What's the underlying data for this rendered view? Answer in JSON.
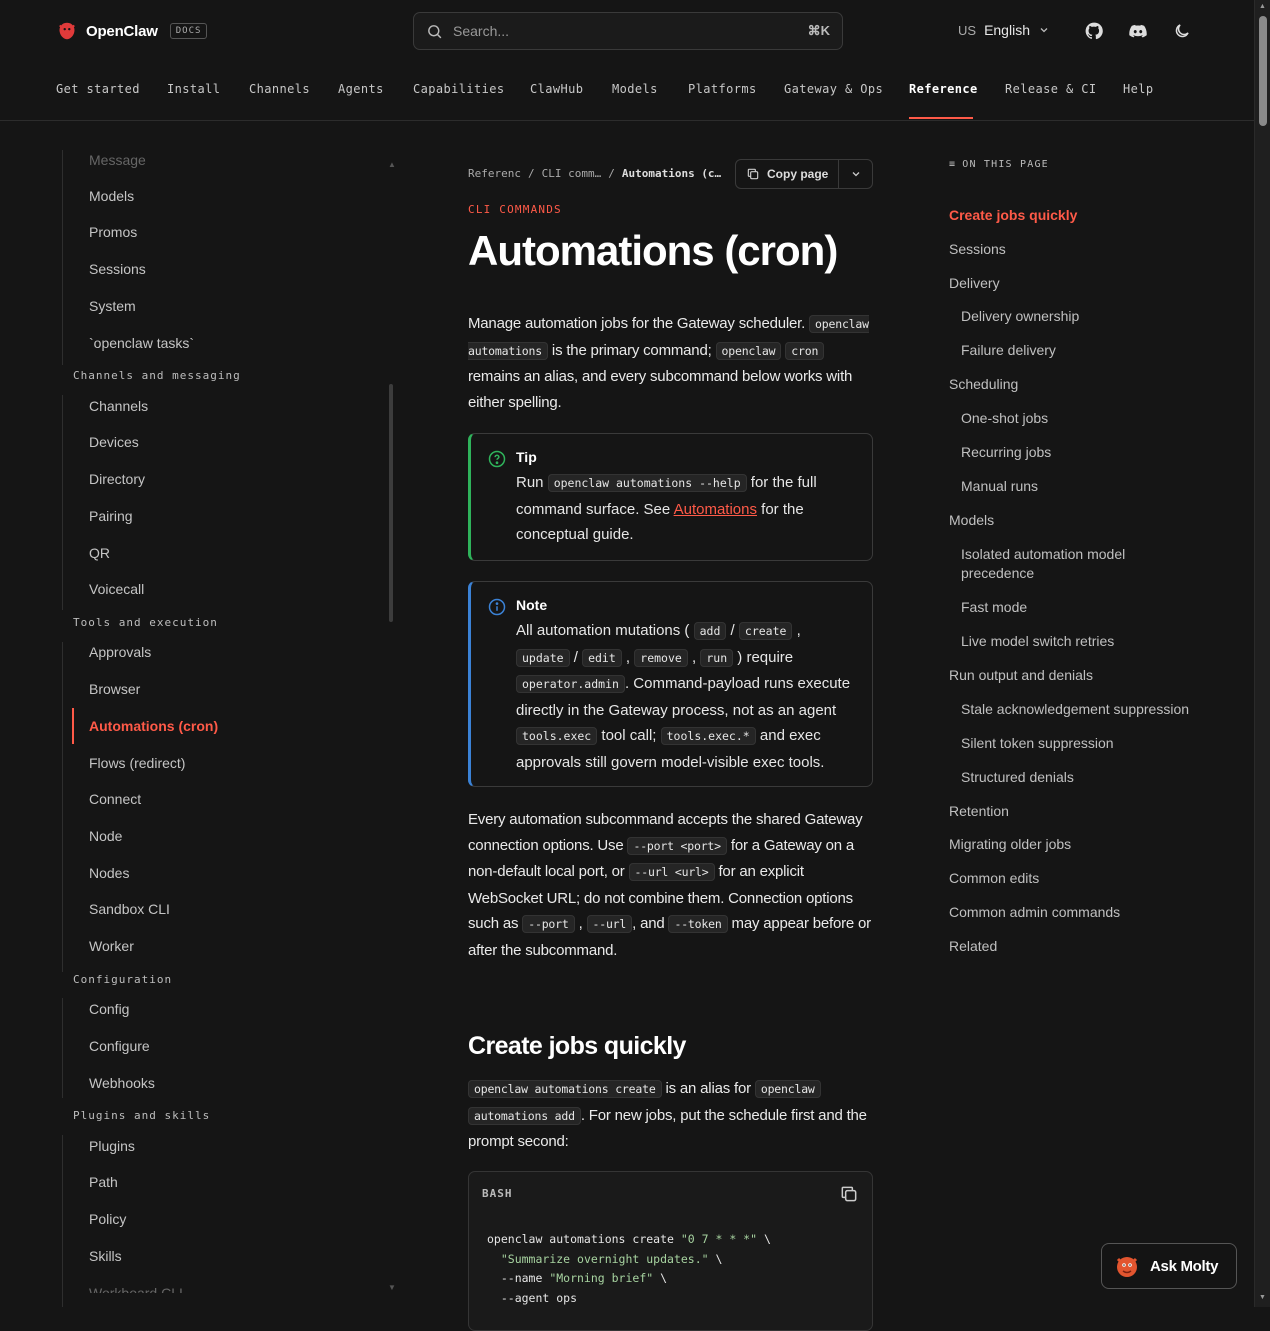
{
  "header": {
    "brand": "OpenClaw",
    "docs_badge": "DOCS",
    "search_placeholder": "Search...",
    "search_shortcut": "⌘K",
    "lang_code": "US",
    "language": "English"
  },
  "nav": {
    "items": [
      "Get started",
      "Install",
      "Channels",
      "Agents",
      "Capabilities",
      "ClawHub",
      "Models",
      "Platforms",
      "Gateway & Ops",
      "Reference",
      "Release & CI",
      "Help"
    ],
    "active": "Reference"
  },
  "sidebar": {
    "cut_top": "Message",
    "items_a": [
      "Models",
      "Promos",
      "Sessions",
      "System",
      "`openclaw tasks`"
    ],
    "section_channels": "Channels and messaging",
    "items_channels": [
      "Channels",
      "Devices",
      "Directory",
      "Pairing",
      "QR",
      "Voicecall"
    ],
    "section_tools": "Tools and execution",
    "items_tools": [
      "Approvals",
      "Browser",
      "Automations (cron)",
      "Flows (redirect)",
      "Connect",
      "Node",
      "Nodes",
      "Sandbox CLI",
      "Worker"
    ],
    "section_config": "Configuration",
    "items_config": [
      "Config",
      "Configure",
      "Webhooks"
    ],
    "section_plugins": "Plugins and skills",
    "items_plugins": [
      "Plugins",
      "Path",
      "Policy",
      "Skills"
    ],
    "cut_bottom": "Workboard CLI"
  },
  "main": {
    "crumbs": [
      "Referenc",
      "/",
      "CLI comm…",
      "/",
      "Automations (c…"
    ],
    "copy_label": "Copy page",
    "eyebrow": "CLI COMMANDS",
    "title": "Automations (cron)",
    "intro": {
      "t1": "Manage automation jobs for the Gateway scheduler.",
      "c1": "openclaw automations",
      "t2": " is the primary command; ",
      "c2": "openclaw",
      "c3": "cron",
      "t3": " remains an alias, and every subcommand below works with either spelling."
    },
    "tip": {
      "title": "Tip",
      "t1": "Run ",
      "c1": "openclaw automations --help",
      "t2": " for the full command surface. See ",
      "link": "Automations",
      "t3": " for the conceptual guide."
    },
    "note": {
      "title": "Note",
      "t1": "All automation mutations ( ",
      "c_add": "add",
      "c_create": "create",
      "c_update": "update",
      "c_edit": "edit",
      "c_remove": "remove",
      "c_run": "run",
      "t2": " ) require ",
      "c_admin": "operator.admin",
      "t3": ". Command-payload runs execute directly in the Gateway process, not as an agent ",
      "c_exec": "tools.exec",
      "t4": " tool call; ",
      "c_exec2": "tools.exec.*",
      "t5": " and exec approvals still govern model-visible exec tools."
    },
    "conn": {
      "t1": "Every automation subcommand accepts the shared Gateway connection options. Use ",
      "c1": "--port <port>",
      "t2": " for a Gateway on a non-default local port, or ",
      "c2": "--url <url>",
      "t3": " for an explicit WebSocket URL; do not combine them. Connection options such as ",
      "c3": "--port",
      "c4": "--url",
      "t4": ", and ",
      "c5": "--token",
      "t5": " may appear before or after the subcommand."
    },
    "h2": "Create jobs quickly",
    "create": {
      "c1": "openclaw automations create",
      "t1": " is an alias for ",
      "c2": "openclaw",
      "c3": "automations add",
      "t2": ". For new jobs, put the schedule first and the prompt second:"
    },
    "code": {
      "lang": "BASH",
      "l1a": "openclaw automations create ",
      "l1b": "\"0 7 * * *\"",
      "l1c": " \\",
      "l2a": "  ",
      "l2b": "\"Summarize overnight updates.\"",
      "l2c": " \\",
      "l3a": "  --name ",
      "l3b": "\"Morning brief\"",
      "l3c": " \\",
      "l4": "  --agent ops"
    }
  },
  "toc": {
    "head": "ON THIS PAGE",
    "items": [
      {
        "label": "Create jobs quickly",
        "level": 0,
        "active": true
      },
      {
        "label": "Sessions",
        "level": 0
      },
      {
        "label": "Delivery",
        "level": 0
      },
      {
        "label": "Delivery ownership",
        "level": 1
      },
      {
        "label": "Failure delivery",
        "level": 1
      },
      {
        "label": "Scheduling",
        "level": 0
      },
      {
        "label": "One-shot jobs",
        "level": 1
      },
      {
        "label": "Recurring jobs",
        "level": 1
      },
      {
        "label": "Manual runs",
        "level": 1
      },
      {
        "label": "Models",
        "level": 0
      },
      {
        "label": "Isolated automation model precedence",
        "level": 1
      },
      {
        "label": "Fast mode",
        "level": 1
      },
      {
        "label": "Live model switch retries",
        "level": 1
      },
      {
        "label": "Run output and denials",
        "level": 0
      },
      {
        "label": "Stale acknowledgement suppression",
        "level": 1
      },
      {
        "label": "Silent token suppression",
        "level": 1
      },
      {
        "label": "Structured denials",
        "level": 1
      },
      {
        "label": "Retention",
        "level": 0
      },
      {
        "label": "Migrating older jobs",
        "level": 0
      },
      {
        "label": "Common edits",
        "level": 0
      },
      {
        "label": "Common admin commands",
        "level": 0
      },
      {
        "label": "Related",
        "level": 0
      }
    ]
  },
  "ask": {
    "label": "Ask Molty"
  },
  "colors": {
    "accent": "#ff5a48",
    "tip": "#2fb35b",
    "note": "#3b82d6",
    "bg": "#151515"
  }
}
